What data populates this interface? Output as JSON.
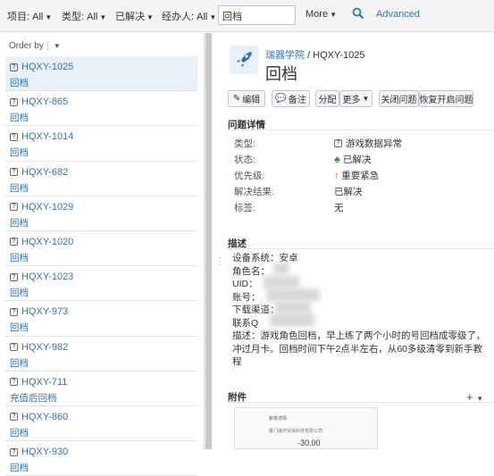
{
  "filters": [
    {
      "label": "项目:",
      "value": "All"
    },
    {
      "label": "类型:",
      "value": "All"
    },
    {
      "label": "",
      "value": "已解决"
    },
    {
      "label": "经办人:",
      "value": "All"
    }
  ],
  "search": {
    "value": "回档"
  },
  "more_label": "More",
  "advanced_label": "Advanced",
  "order_by_label": "Order by",
  "issues": [
    {
      "key": "HQXY-1025",
      "summary": "回档",
      "selected": true
    },
    {
      "key": "HQXY-865",
      "summary": "回档"
    },
    {
      "key": "HQXY-1014",
      "summary": "回档"
    },
    {
      "key": "HQXY-682",
      "summary": "回档"
    },
    {
      "key": "HQXY-1029",
      "summary": "回档"
    },
    {
      "key": "HQXY-1020",
      "summary": "回档"
    },
    {
      "key": "HQXY-1023",
      "summary": "回档"
    },
    {
      "key": "HQXY-973",
      "summary": "回档"
    },
    {
      "key": "HQXY-982",
      "summary": "回档"
    },
    {
      "key": "HQXY-711",
      "summary": "充值后回档"
    },
    {
      "key": "HQXY-860",
      "summary": "回档"
    },
    {
      "key": "HQXY-930",
      "summary": "回档"
    }
  ],
  "detail": {
    "project": "瑞器学院",
    "issue_key": "HQXY-1025",
    "title": "回档",
    "buttons": {
      "edit": "编辑",
      "comment": "备注",
      "assign": "分配",
      "more": "更多",
      "close": "关闭问题",
      "reopen": "恢复开启问题"
    },
    "details_heading": "问题详情",
    "fields": [
      {
        "label": "类型:",
        "value": "游戏数据异常"
      },
      {
        "label": "状态:",
        "value": "已解决"
      },
      {
        "label": "优先级:",
        "value": "重要紧急"
      },
      {
        "label": "解决结果:",
        "value": "已解决"
      },
      {
        "label": "标签:",
        "value": "无"
      }
    ],
    "description_heading": "描述",
    "description": {
      "system": "设备系统：安卓",
      "role": "角色名：",
      "uid": "UID：",
      "account": "账号：",
      "channel": "下载渠道：",
      "contact": "联系Q",
      "body": "描述：游戏角色回档，早上练了两个小时的号回档成零级了，冲过月卡。回档时间下午2点半左右，从60多级清零到新手教程"
    },
    "attachments_heading": "附件",
    "attachment": {
      "line1": "账单详情",
      "line2": "厦门爆炸贸易科技有限公司",
      "amount": "-30.00"
    }
  },
  "colors": {
    "link": "#3572b0",
    "toolbar_bg": "#f4f5f7",
    "selected_row": "#e9f0f8"
  }
}
